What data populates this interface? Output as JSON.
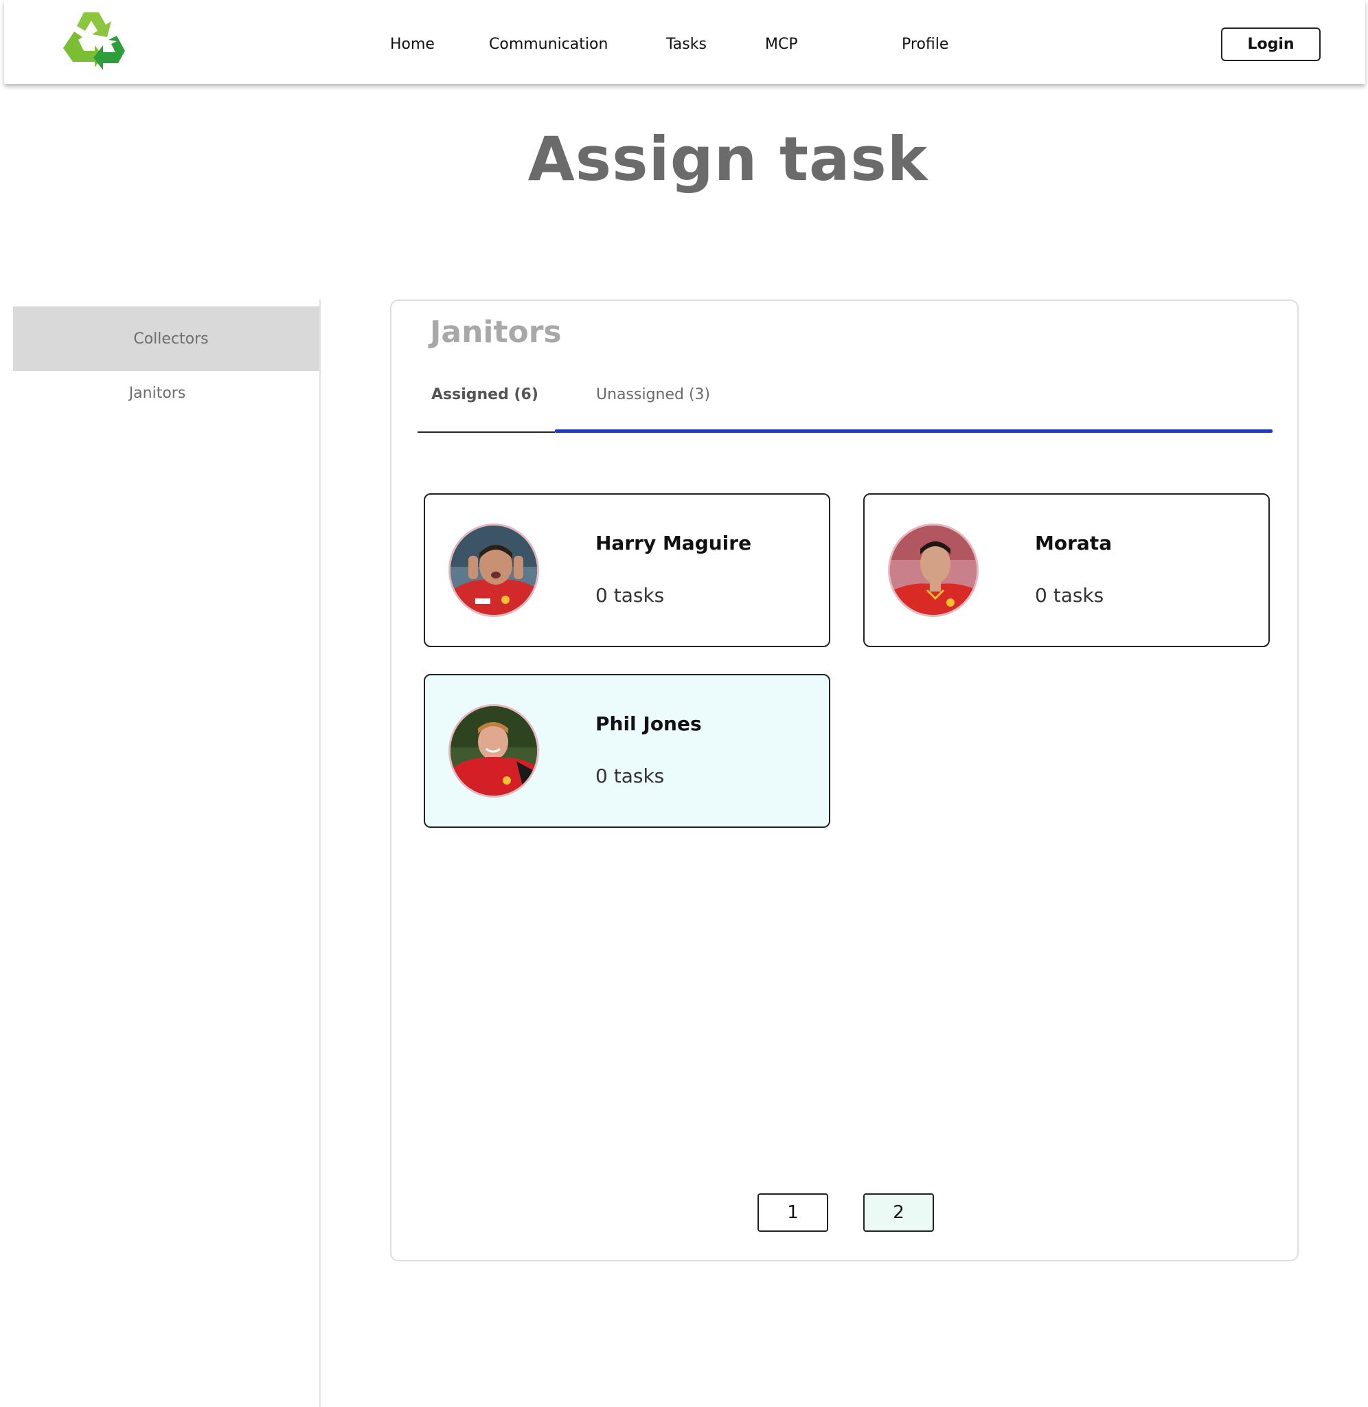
{
  "nav": {
    "logo_icon": "recycle-icon",
    "items": [
      {
        "label": "Home"
      },
      {
        "label": "Communication"
      },
      {
        "label": "Tasks"
      },
      {
        "label": "MCP"
      },
      {
        "label": "Profile"
      }
    ],
    "login_label": "Login"
  },
  "page": {
    "title": "Assign task"
  },
  "sidebar": {
    "items": [
      {
        "label": "Collectors",
        "active": true
      },
      {
        "label": "Janitors",
        "active": false
      }
    ]
  },
  "panel": {
    "title": "Janitors",
    "tabs": [
      {
        "label": "Assigned (6)",
        "active": true
      },
      {
        "label": "Unassigned (3)",
        "active": false
      }
    ],
    "cards": [
      {
        "name": "Harry Maguire",
        "tasks": "0 tasks",
        "highlighted": false
      },
      {
        "name": "Morata",
        "tasks": "0 tasks",
        "highlighted": false
      },
      {
        "name": "Phil Jones",
        "tasks": "0 tasks",
        "highlighted": true
      }
    ],
    "pagination": {
      "pages": [
        "1",
        "2"
      ],
      "current": "2"
    }
  },
  "colors": {
    "active_tab_underline": "#1a37d8",
    "sidebar_active_bg": "#d9d9d9",
    "highlight_card_bg": "#ecfcfd",
    "logo_light_green": "#8cc63f",
    "logo_dark_green": "#2e9e3a"
  }
}
